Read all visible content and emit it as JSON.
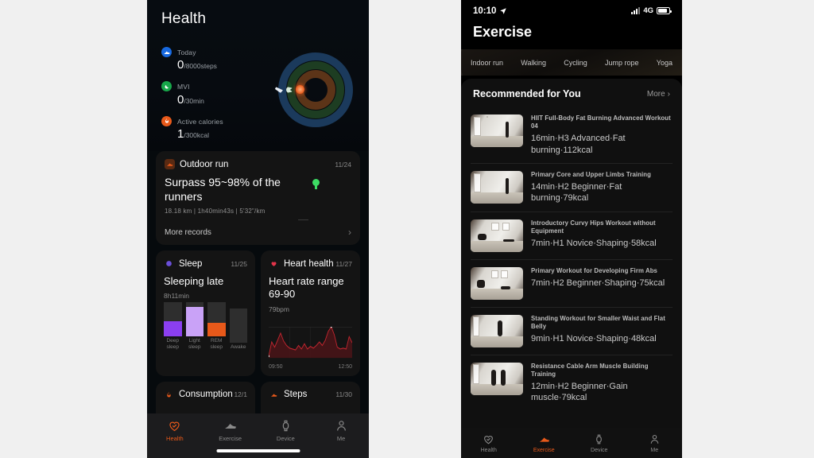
{
  "page": {
    "background": "#f0f0f0"
  },
  "left_phone": {
    "title": "Health",
    "metrics": [
      {
        "label": "Today",
        "value": "0",
        "unit": "/8000steps",
        "color": "#1769e0",
        "icon": "shoe-icon"
      },
      {
        "label": "MVI",
        "value": "0",
        "unit": "/30min",
        "color": "#17a84a",
        "icon": "moon-icon"
      },
      {
        "label": "Active calories",
        "value": "1",
        "unit": "/300kcal",
        "color": "#e8591a",
        "icon": "flame-icon"
      }
    ],
    "rings": {
      "outer_color": "#1b3a5c",
      "middle_color": "#1d3d22",
      "inner_color": "#5c3418"
    },
    "run_card": {
      "icon": "run-icon",
      "icon_color": "#e8591a",
      "title": "Outdoor run",
      "date": "11/24",
      "headline": "Surpass 95~98% of the runners",
      "stats": "18.18 km | 1h40min43s |  5'32\"/km",
      "more_label": "More records",
      "chevron": "chevron-right-icon",
      "pin_color": "#3ddc64"
    },
    "sleep_card": {
      "icon": "sleep-icon",
      "icon_color": "#6a4fd8",
      "title": "Sleep",
      "date": "11/25",
      "headline": "Sleeping late",
      "duration": "8h11min"
    },
    "heart_card": {
      "icon": "heart-icon",
      "icon_color": "#e3344a",
      "title": "Heart health",
      "date": "11/27",
      "headline": "Heart rate range 69-90",
      "bpm": "79bpm",
      "axis_start": "09:50",
      "axis_end": "12:50"
    },
    "consumption_card": {
      "icon": "flame-icon",
      "icon_color": "#e8591a",
      "title": "Consumption",
      "date": "12/1"
    },
    "steps_card": {
      "icon": "shoe-icon",
      "icon_color": "#e8591a",
      "title": "Steps",
      "date": "11/30"
    },
    "tabbar": {
      "active_color": "#e8591a",
      "inactive_color": "#8a8a8a",
      "items": [
        {
          "label": "Health",
          "icon": "heart-check-icon",
          "active": true
        },
        {
          "label": "Exercise",
          "icon": "shoe-icon",
          "active": false
        },
        {
          "label": "Device",
          "icon": "watch-icon",
          "active": false
        },
        {
          "label": "Me",
          "icon": "person-icon",
          "active": false
        }
      ]
    }
  },
  "right_phone": {
    "status_bar": {
      "time": "10:10",
      "location_icon": "location-arrow-icon",
      "signal_icon": "signal-bars-icon",
      "network": "4G",
      "battery_icon": "battery-icon"
    },
    "title": "Exercise",
    "tabs": [
      {
        "label": "Indoor run"
      },
      {
        "label": "Walking"
      },
      {
        "label": "Cycling"
      },
      {
        "label": "Jump rope"
      },
      {
        "label": "Yoga"
      }
    ],
    "recommended": {
      "title": "Recommended for You",
      "more_label": "More",
      "more_icon": "chevron-right-icon",
      "items": [
        {
          "name": "HIIT Full-Body Fat Burning Advanced Workout 04",
          "meta": "16min·H3 Advanced·Fat burning·112kcal"
        },
        {
          "name": "Primary Core and Upper Limbs Training",
          "meta": "14min·H2 Beginner·Fat burning·79kcal"
        },
        {
          "name": "Introductory Curvy Hips Workout without Equipment",
          "meta": "7min·H1 Novice·Shaping·58kcal"
        },
        {
          "name": "Primary Workout for Developing Firm Abs",
          "meta": "7min·H2 Beginner·Shaping·75kcal"
        },
        {
          "name": "Standing Workout for Smaller Waist and Flat Belly",
          "meta": "9min·H1 Novice·Shaping·48kcal"
        },
        {
          "name": "Resistance Cable Arm Muscle Building Training",
          "meta": "12min·H2 Beginner·Gain muscle·79kcal"
        }
      ]
    },
    "tabbar": {
      "active_color": "#e8591a",
      "inactive_color": "#8a8a8a",
      "items": [
        {
          "label": "Health",
          "icon": "heart-check-icon",
          "active": false
        },
        {
          "label": "Exercise",
          "icon": "shoe-icon",
          "active": true
        },
        {
          "label": "Device",
          "icon": "watch-icon",
          "active": false
        },
        {
          "label": "Me",
          "icon": "person-icon",
          "active": false
        }
      ]
    }
  },
  "chart_data": [
    {
      "type": "bar",
      "title": "Sleep stages",
      "categories": [
        "Deep sleep",
        "Light sleep",
        "REM sleep",
        "Awake"
      ],
      "values": [
        46,
        86,
        41,
        0
      ],
      "colors": [
        "#8b3ff0",
        "#c9a2f7",
        "#e8591a",
        "#3a3a3a"
      ],
      "track_color": "#2e2e2e",
      "ylim": [
        0,
        100
      ],
      "xlabel": "",
      "ylabel": "",
      "grid": false
    },
    {
      "type": "area",
      "title": "Heart rate range",
      "xlabel": "",
      "ylabel": "bpm",
      "x": [
        "09:50",
        "12:50"
      ],
      "line_color": "#c0262f",
      "fill_color": "#4a1418",
      "grid": true,
      "ylim": [
        60,
        95
      ],
      "values": [
        62,
        78,
        72,
        80,
        88,
        79,
        74,
        71,
        70,
        69,
        74,
        70,
        76,
        70,
        73,
        71,
        74,
        78,
        74,
        80,
        90,
        95,
        86,
        72,
        70,
        71,
        70,
        84,
        77
      ]
    }
  ]
}
